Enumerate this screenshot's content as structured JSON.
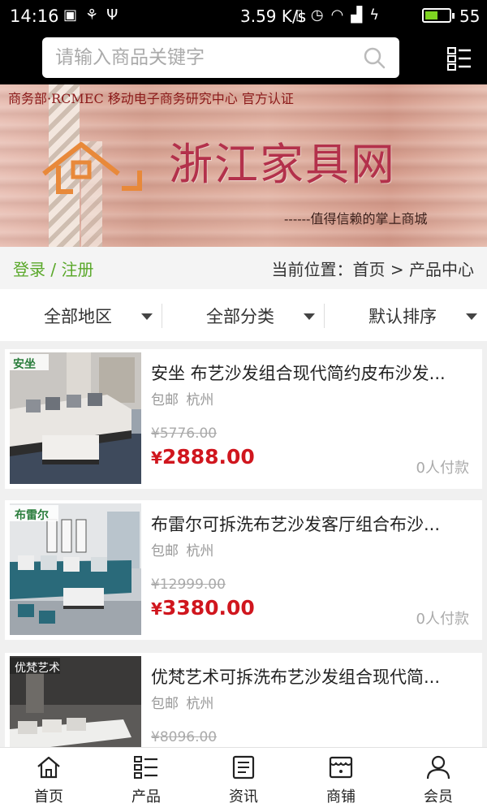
{
  "status_bar": {
    "time": "14:16",
    "network_speed": "3.59 K/s",
    "battery_percent": "55",
    "battery_level": 0.55,
    "icons_left": [
      "image-icon",
      "usb-icon",
      "usb-debug-icon"
    ],
    "icons_right": [
      "vibrate-icon",
      "alarm-icon",
      "wifi-icon",
      "signal-4g-icon",
      "charging-icon",
      "battery-icon"
    ]
  },
  "search": {
    "placeholder": "请输入商品关键字",
    "value": ""
  },
  "banner": {
    "top_text": "商务部·RCMEC 移动电子商务研究中心 官方认证",
    "title": "浙江家具网",
    "slogan": "------值得信赖的掌上商城",
    "accent_color": "#e8893a"
  },
  "account": {
    "login": "登录",
    "separator": "/",
    "register": "注册",
    "link_color": "#5aa82a"
  },
  "breadcrumb": {
    "text": "当前位置：首页 > 产品中心"
  },
  "filters": [
    {
      "label": "全部地区"
    },
    {
      "label": "全部分类"
    },
    {
      "label": "默认排序"
    }
  ],
  "products": [
    {
      "name": "安坐 布艺沙发组合现代简约皮布沙发...",
      "tags": [
        "包邮",
        "杭州"
      ],
      "old_price": "¥5776.00",
      "price_symbol": "¥",
      "price": "2888.00",
      "paid": "0人付款",
      "brand_badge": "安坐"
    },
    {
      "name": "布雷尔可拆洗布艺沙发客厅组合布沙...",
      "tags": [
        "包邮",
        "杭州"
      ],
      "old_price": "¥12999.00",
      "price_symbol": "¥",
      "price": "3380.00",
      "paid": "0人付款",
      "brand_badge": "布雷尔"
    },
    {
      "name": "优梵艺术可拆洗布艺沙发组合现代简...",
      "tags": [
        "包邮",
        "杭州"
      ],
      "old_price": "¥8096.00",
      "price_symbol": "¥",
      "price": "",
      "paid": "",
      "brand_badge": "优梵艺术"
    }
  ],
  "price_color": "#d0161e",
  "bottom_nav": [
    {
      "label": "首页",
      "icon": "home-icon"
    },
    {
      "label": "产品",
      "icon": "product-grid-icon"
    },
    {
      "label": "资讯",
      "icon": "news-icon"
    },
    {
      "label": "商铺",
      "icon": "store-icon"
    },
    {
      "label": "会员",
      "icon": "member-icon"
    }
  ]
}
